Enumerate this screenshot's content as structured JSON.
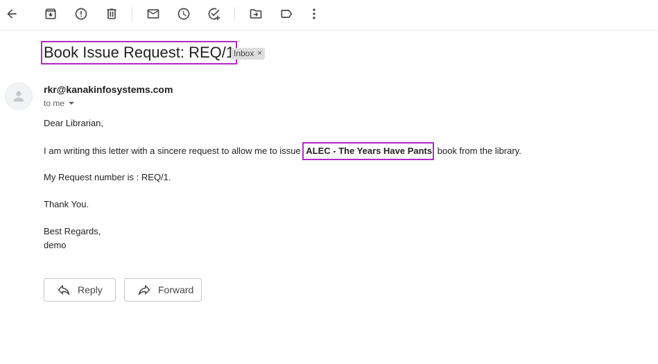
{
  "toolbar": {
    "icons": [
      "back-arrow-icon",
      "archive-icon",
      "report-spam-icon",
      "delete-icon",
      "mark-unread-icon",
      "snooze-icon",
      "add-task-icon",
      "move-to-icon",
      "label-icon",
      "more-options-icon"
    ]
  },
  "email": {
    "subject": "Book Issue Request: REQ/1",
    "label": "Inbox",
    "label_close": "×",
    "sender": "rkr@kanakinfosystems.com",
    "recipient": "to me",
    "body": {
      "greeting": "Dear Librarian,",
      "line1_before": "I am writing this letter with a sincere request to allow me to issue",
      "line1_book": "ALEC - The Years Have Pants",
      "line1_after": "book from the library.",
      "line2": "My Request number is : REQ/1.",
      "line3": "Thank You.",
      "closing": "Best Regards,",
      "signature": "demo"
    }
  },
  "actions": {
    "reply": "Reply",
    "forward": "Forward"
  },
  "colors": {
    "highlight": "#b02ac7",
    "icon": "#444746"
  }
}
